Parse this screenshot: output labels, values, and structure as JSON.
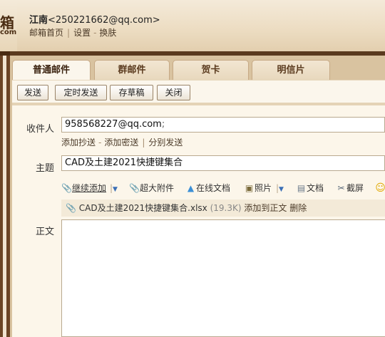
{
  "header": {
    "logo_main": "箱",
    "logo_sub": "com",
    "user_name": "江南",
    "user_email": "<250221662@qq.com>",
    "links": [
      "邮箱首页",
      "设置",
      "换肤"
    ]
  },
  "tabs": [
    "普通邮件",
    "群邮件",
    "贺卡",
    "明信片"
  ],
  "toolbar": {
    "send": "发送",
    "schedule": "定时发送",
    "draft": "存草稿",
    "close": "关闭"
  },
  "form": {
    "to_label": "收件人",
    "to_value": "958568227@qq.com",
    "to_suffix": ";",
    "add_cc": "添加抄送",
    "add_bcc": "添加密送",
    "separate_send": "分别发送",
    "subject_label": "主题",
    "subject_value": "CAD及土建2021快捷键集合",
    "body_label": "正文"
  },
  "attach_bar": {
    "continue_add": "继续添加",
    "large_attach": "超大附件",
    "online_doc": "在线文档",
    "photo": "照片",
    "doc": "文档",
    "screenshot": "截屏"
  },
  "attachment": {
    "filename": "CAD及土建2021快捷键集合.xlsx",
    "size": "(19.3K)",
    "add_to_body": "添加到正文",
    "delete": "删除"
  },
  "colors": {
    "accent_brown": "#5a3a1e",
    "panel_tan": "#d9c3a0",
    "link_blue": "#3b6fb6"
  }
}
